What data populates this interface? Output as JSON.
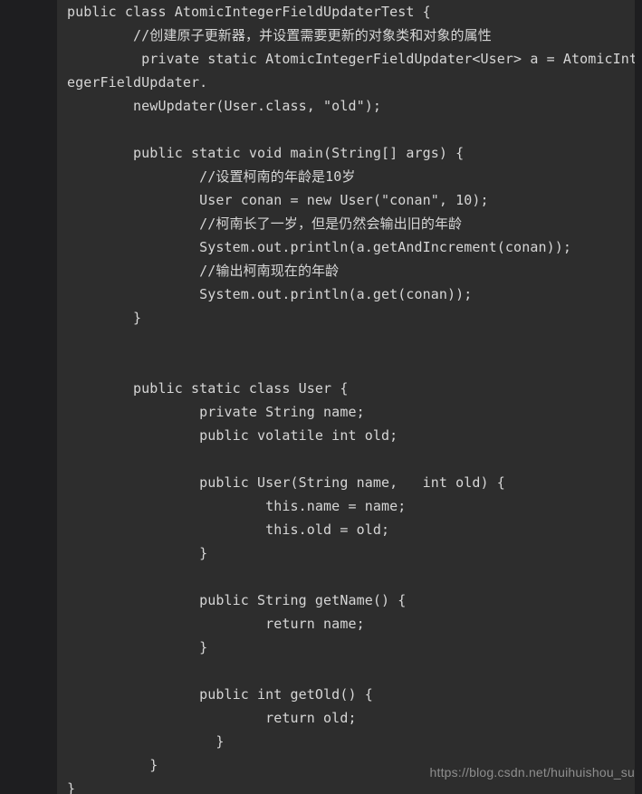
{
  "colors": {
    "page_background": "#1e1e20",
    "code_background": "#2d2d2d",
    "code_text": "#d6d6d6",
    "watermark_text": "#8e8e8e"
  },
  "code": {
    "language": "java",
    "lines": [
      "public class AtomicIntegerFieldUpdaterTest {",
      "        //创建原子更新器，并设置需要更新的对象类和对象的属性",
      "         private static AtomicIntegerFieldUpdater<User> a = AtomicInt",
      "egerFieldUpdater.",
      "        newUpdater(User.class, \"old\");",
      "",
      "        public static void main(String[] args) {",
      "                //设置柯南的年龄是10岁",
      "                User conan = new User(\"conan\", 10);",
      "                //柯南长了一岁，但是仍然会输出旧的年龄",
      "                System.out.println(a.getAndIncrement(conan));",
      "                //输出柯南现在的年龄",
      "                System.out.println(a.get(conan));",
      "        }",
      "",
      "",
      "        public static class User {",
      "                private String name;",
      "                public volatile int old;",
      "",
      "                public User(String name,   int old) {",
      "                        this.name = name;",
      "                        this.old = old;",
      "                }",
      "",
      "                public String getName() {",
      "                        return name;",
      "                }",
      "",
      "                public int getOld() {",
      "                        return old;",
      "                  }",
      "          }",
      "}"
    ]
  },
  "watermark": {
    "url": "https://blog.csdn.net/huihuishou_su"
  }
}
